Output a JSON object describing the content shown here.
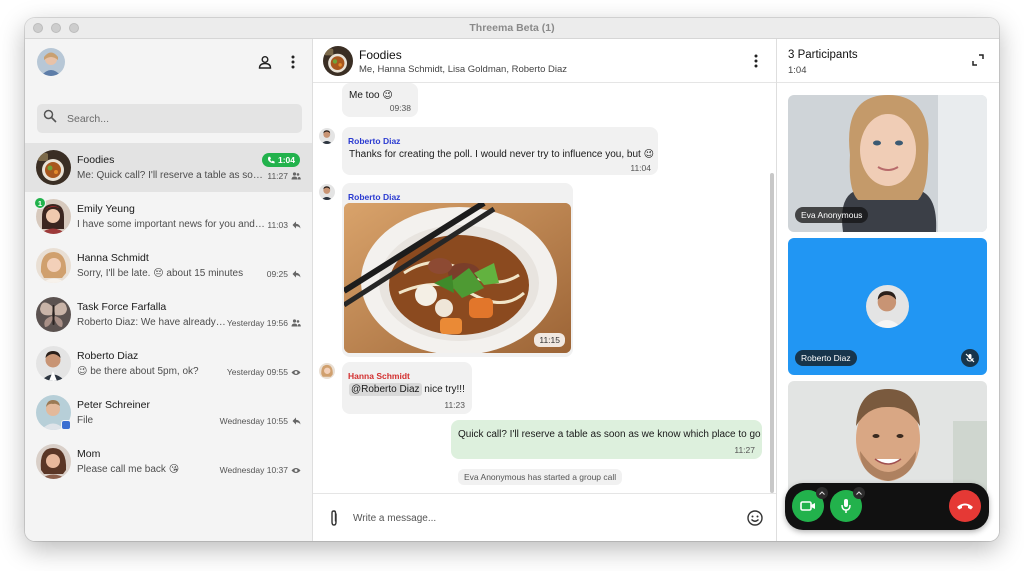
{
  "window": {
    "title": "Threema Beta (1)"
  },
  "sidebar": {
    "search_placeholder": "Search...",
    "conversations": [
      {
        "name": "Foodies",
        "preview": "Me: Quick call? I'll reserve a table as soon as we know which place to go",
        "time": "11:27",
        "call_badge": "1:04",
        "status_icon": "group-icon"
      },
      {
        "name": "Emily Yeung",
        "preview": "I have some important news for you and everyone",
        "time": "11:03",
        "unread": "1",
        "status_icon": "reply-icon"
      },
      {
        "name": "Hanna Schmidt",
        "preview": "Sorry, I'll be late. 😔 about 15 minutes",
        "time": "09:25",
        "status_icon": "reply-icon"
      },
      {
        "name": "Task Force Farfalla",
        "preview": "Roberto Diaz: We have already decided",
        "time": "Yesterday 19:56",
        "status_icon": "group-icon"
      },
      {
        "name": "Roberto Diaz",
        "preview": "😉 be there about 5pm, ok?",
        "time": "Yesterday 09:55",
        "status_icon": "eye-icon"
      },
      {
        "name": "Peter Schreiner",
        "preview": "File",
        "time": "Wednesday 10:55",
        "status_icon": "reply-icon"
      },
      {
        "name": "Mom",
        "preview": "Please call me back 😘",
        "time": "Wednesday 10:37",
        "status_icon": "eye-icon"
      }
    ]
  },
  "chat": {
    "name": "Foodies",
    "members": "Me, Hanna Schmidt, Lisa Goldman, Roberto Diaz",
    "messages": [
      {
        "text": "Me too 😉",
        "time": "09:38"
      },
      {
        "sender": "Roberto Diaz",
        "text": "Thanks for creating the poll. I would never try to influence you, but 😉",
        "time": "11:04"
      },
      {
        "sender": "Roberto Diaz",
        "time": "11:15"
      },
      {
        "sender": "Hanna Schmidt",
        "mention": "@Roberto Diaz",
        "text": "nice try!!!",
        "time": "11:23"
      },
      {
        "text": "Quick call? I'll reserve a table as soon as we know which place to go",
        "time": "11:27"
      }
    ],
    "system_message": "Eva Anonymous has started a group call",
    "composer_placeholder": "Write a message..."
  },
  "call": {
    "participants_label": "3 Participants",
    "duration": "1:04",
    "tiles": [
      {
        "name": "Eva Anonymous"
      },
      {
        "name": "Roberto Diaz",
        "muted": true
      },
      {
        "name": ""
      }
    ]
  },
  "colors": {
    "accent_green": "#22b24c",
    "hangup_red": "#e53935",
    "sender_blue": "#2b3bd1",
    "sender_red": "#d32f2f",
    "tile_blue": "#2196f3",
    "outgoing_bubble": "#ddf0dd"
  }
}
